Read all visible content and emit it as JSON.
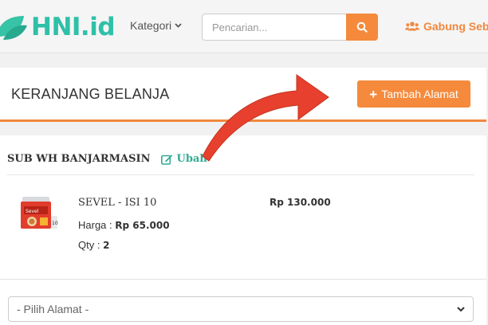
{
  "header": {
    "logo_text": "HNI.id",
    "kategori_label": "Kategori",
    "search_placeholder": "Pencarian...",
    "join_label": "Gabung Seba"
  },
  "cart": {
    "title": "KERANJANG BELANJA",
    "add_address_label": "Tambah Alamat",
    "warehouse": "SUB WH BANJARMASIN",
    "edit_label": "Ubah",
    "item": {
      "name": "SEVEL - ISI 10",
      "price_label": "Harga :",
      "price_value": "Rp 65.000",
      "qty_label": "Qty :",
      "qty_value": "2",
      "subtotal": "Rp 130.000"
    },
    "address_select": "- Pilih Alamat -"
  },
  "colors": {
    "brand_teal": "#2fc0a8",
    "accent_orange": "#f58a3c",
    "annotation_red": "#e8402e"
  }
}
